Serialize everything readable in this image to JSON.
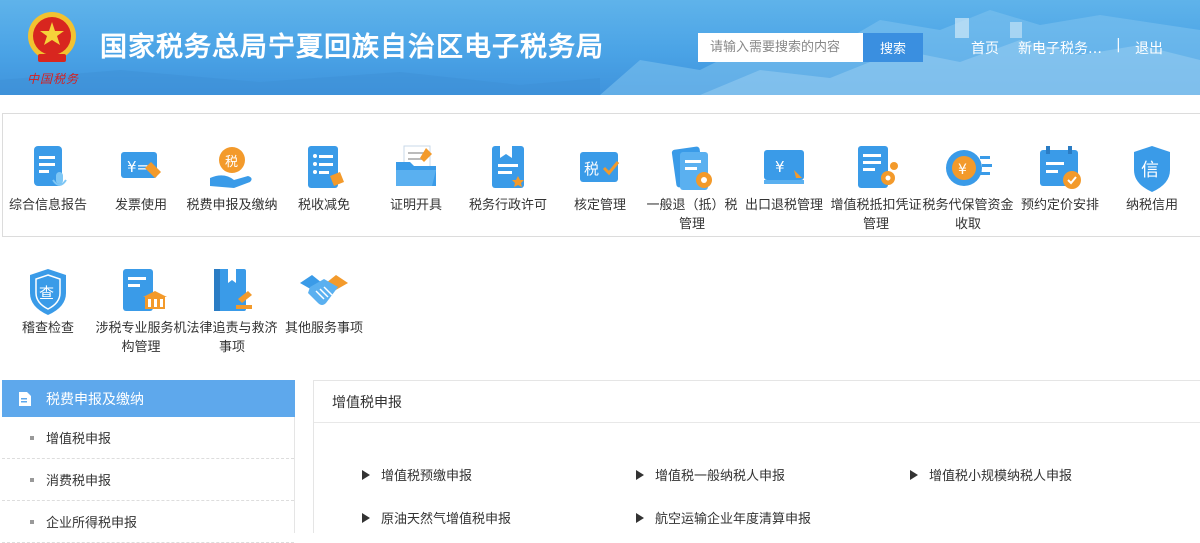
{
  "header": {
    "emblem_caption": "中国税务",
    "title": "国家税务总局宁夏回族自治区电子税务局",
    "search_placeholder": "请输入需要搜索的内容",
    "search_label": "搜索",
    "nav": {
      "home": "首页",
      "new": "新电子税务…",
      "separator": "|",
      "logout": "退出"
    }
  },
  "menu": [
    {
      "label": "综合信息报告",
      "icon": "report-mic-icon"
    },
    {
      "label": "发票使用",
      "icon": "invoice-icon"
    },
    {
      "label": "税费申报及缴纳",
      "icon": "tax-declare-icon"
    },
    {
      "label": "税收减免",
      "icon": "tax-relief-icon"
    },
    {
      "label": "证明开具",
      "icon": "certificate-folder-icon"
    },
    {
      "label": "税务行政许可",
      "icon": "admin-license-icon"
    },
    {
      "label": "核定管理",
      "icon": "verify-tax-icon"
    },
    {
      "label": "一般退（抵）税管理",
      "icon": "refund-gear-icon"
    },
    {
      "label": "出口退税管理",
      "icon": "export-refund-icon"
    },
    {
      "label": "增值税抵扣凭证管理",
      "icon": "vat-voucher-icon"
    },
    {
      "label": "税务代保管资金收取",
      "icon": "fund-custody-icon"
    },
    {
      "label": "预约定价安排",
      "icon": "calendar-pricing-icon"
    },
    {
      "label": "纳税信用",
      "icon": "credit-shield-icon"
    },
    {
      "label": "稽查检查",
      "icon": "inspect-shield-icon"
    },
    {
      "label": "涉税专业服务机构管理",
      "icon": "agency-building-icon"
    },
    {
      "label": "法律追责与救济事项",
      "icon": "law-book-icon"
    },
    {
      "label": "其他服务事项",
      "icon": "handshake-icon"
    }
  ],
  "sidebar": {
    "title": "税费申报及缴纳",
    "items": [
      "增值税申报",
      "消费税申报",
      "企业所得税申报"
    ]
  },
  "content": {
    "title": "增值税申报",
    "links": [
      "增值税预缴申报",
      "增值税一般纳税人申报",
      "增值税小规模纳税人申报",
      "原油天然气增值税申报",
      "航空运输企业年度清算申报"
    ]
  },
  "colors": {
    "header_blue": "#4aa3e6",
    "accent_blue": "#3a8fe0",
    "sidebar_head": "#5ea8ec",
    "icon_blue": "#3a9be8",
    "icon_orange": "#f39a2b"
  }
}
